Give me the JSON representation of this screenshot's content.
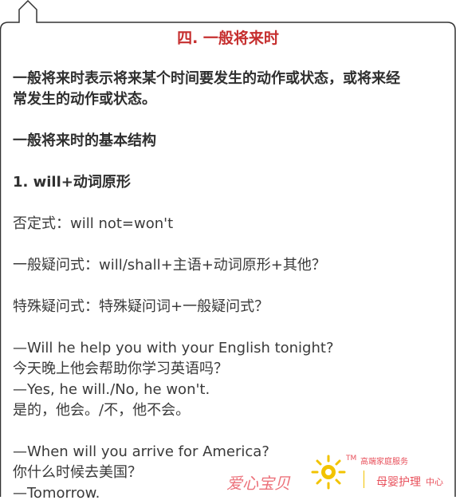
{
  "header": {
    "title": "四. 一般将来时"
  },
  "body": {
    "intro_1": "一般将来时表示将来某个时间要发生的动作或状态，或将来经",
    "intro_2": "常发生的动作或状态。",
    "structure_heading": "一般将来时的基本结构",
    "rule_1": "1. will+动词原形",
    "negative": "否定式：will not=won't",
    "general_question": "一般疑问式：will/shall+主语+动词原形+其他？",
    "special_question": "特殊疑问式：特殊疑问词+一般疑问式？",
    "example_1_q_en": "—Will he help you with your English tonight?",
    "example_1_q_zh": "今天晚上他会帮助你学习英语吗？",
    "example_1_a_en": "—Yes, he will./No, he won't.",
    "example_1_a_zh": "是的，他会。/不，他不会。",
    "example_2_q_en": "—When will you arrive for America?",
    "example_2_q_zh": "你什么时候去美国？",
    "example_2_a_en": "—Tomorrow."
  },
  "watermark": {
    "brand": "爱心宝贝",
    "tm": "TM",
    "slogan": "高端家庭服务",
    "center_main": "母婴护理",
    "center_suffix": "中心"
  },
  "colors": {
    "title": "#c62f2f",
    "watermark_red": "#e8505b",
    "logo_yellow": "#f2c300",
    "frame": "#333333"
  }
}
